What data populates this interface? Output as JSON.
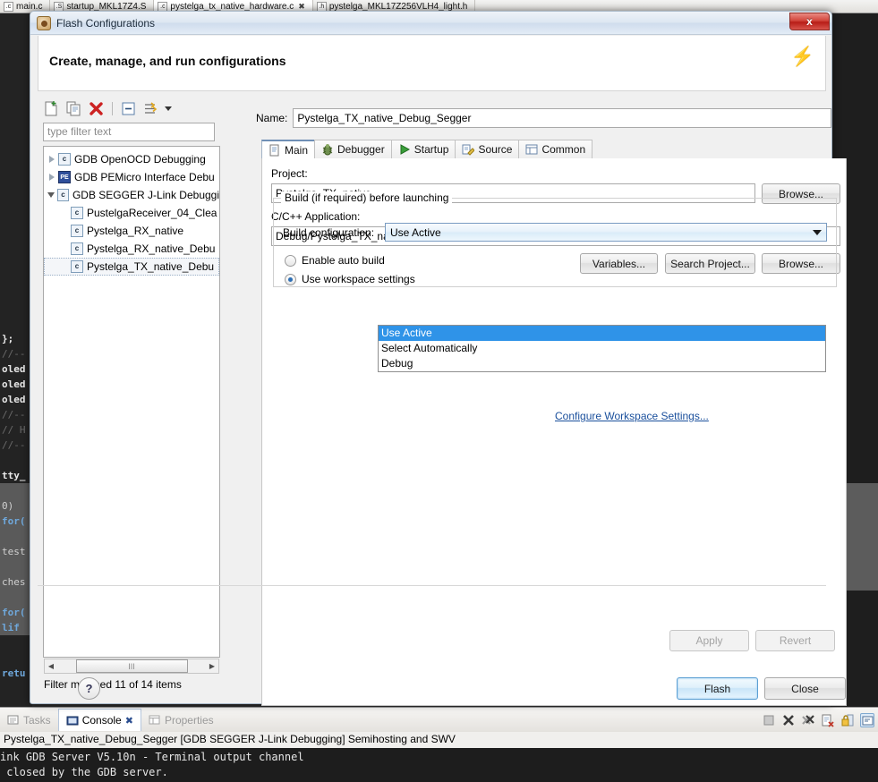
{
  "editor_tabs": [
    {
      "label": "main.c",
      "icon": "c-file-icon",
      "badge": ".c",
      "active": false,
      "closable": false
    },
    {
      "label": "startup_MKL17Z4.S",
      "icon": "asm-file-icon",
      "badge": ".S",
      "active": false,
      "closable": false
    },
    {
      "label": "pystelga_tx_native_hardware.c",
      "icon": "c-file-icon",
      "badge": ".c",
      "active": true,
      "closable": true
    },
    {
      "label": "pystelga_MKL17Z256VLH4_light.h",
      "icon": "h-file-icon",
      "badge": ".h",
      "active": false,
      "closable": false
    }
  ],
  "code_strip": [
    {
      "text": "};",
      "cls": "c-bold",
      "hl": false
    },
    {
      "text": "//--",
      "cls": "c-com",
      "hl": false
    },
    {
      "text": "oled",
      "cls": "c-bold",
      "hl": false
    },
    {
      "text": "oled",
      "cls": "c-bold",
      "hl": false
    },
    {
      "text": "oled",
      "cls": "c-bold",
      "hl": false
    },
    {
      "text": "//--",
      "cls": "c-com",
      "hl": false
    },
    {
      "text": "// H",
      "cls": "c-com",
      "hl": false
    },
    {
      "text": "//--",
      "cls": "c-com",
      "hl": false
    },
    {
      "text": "",
      "cls": "c-plain",
      "hl": false
    },
    {
      "text": "tty_",
      "cls": "c-bold",
      "hl": false
    },
    {
      "text": "",
      "cls": "c-plain",
      "hl": true
    },
    {
      "text": "0)",
      "cls": "c-plain",
      "hl": true
    },
    {
      "text": "for(",
      "cls": "c-kw",
      "hl": true
    },
    {
      "text": "",
      "cls": "c-plain",
      "hl": true
    },
    {
      "text": "test",
      "cls": "c-plain",
      "hl": true
    },
    {
      "text": "",
      "cls": "c-plain",
      "hl": true
    },
    {
      "text": "ches",
      "cls": "c-plain",
      "hl": true
    },
    {
      "text": "",
      "cls": "c-plain",
      "hl": true
    },
    {
      "text": "for(",
      "cls": "c-kw",
      "hl": true
    },
    {
      "text": "lif",
      "cls": "c-kw",
      "hl": true
    },
    {
      "text": "",
      "cls": "c-plain",
      "hl": false
    },
    {
      "text": "",
      "cls": "c-plain",
      "hl": false
    },
    {
      "text": "retu",
      "cls": "c-kw",
      "hl": false
    }
  ],
  "dialog": {
    "title": "Flash Configurations",
    "title_icon": "flash-config-icon",
    "close_label": "x",
    "header_title": "Create, manage, and run configurations",
    "header_icon": "lightning-bolt-icon"
  },
  "tree_toolbar": [
    {
      "name": "new-configuration-button",
      "icon": "new-document-icon"
    },
    {
      "name": "duplicate-configuration-button",
      "icon": "copy-icon"
    },
    {
      "name": "delete-configuration-button",
      "icon": "red-x-icon"
    },
    {
      "name": "collapse-all-button",
      "icon": "collapse-all-icon"
    },
    {
      "name": "filter-button",
      "icon": "filter-icon"
    }
  ],
  "filter": {
    "placeholder": "type filter text",
    "value": "",
    "status": "Filter matched 11 of 14 items"
  },
  "tree": [
    {
      "label": "GDB OpenOCD Debugging",
      "level": 0,
      "expander": "collapsed",
      "icon": "c-config-icon",
      "selected": false
    },
    {
      "label": "GDB PEMicro Interface Debu",
      "level": 0,
      "expander": "collapsed",
      "icon": "pemicro-icon",
      "selected": false
    },
    {
      "label": "GDB SEGGER J-Link Debuggi",
      "level": 0,
      "expander": "expanded",
      "icon": "c-config-icon",
      "selected": false
    },
    {
      "label": "PustelgaReceiver_04_Clea",
      "level": 1,
      "expander": "none",
      "icon": "c-config-icon",
      "selected": false
    },
    {
      "label": "Pystelga_RX_native",
      "level": 1,
      "expander": "none",
      "icon": "c-config-icon",
      "selected": false
    },
    {
      "label": "Pystelga_RX_native_Debu",
      "level": 1,
      "expander": "none",
      "icon": "c-config-icon",
      "selected": false
    },
    {
      "label": "Pystelga_TX_native_Debu",
      "level": 1,
      "expander": "none",
      "icon": "c-config-icon",
      "selected": true
    }
  ],
  "config": {
    "name_label": "Name:",
    "name_value": "Pystelga_TX_native_Debug_Segger",
    "tabs": [
      {
        "label": "Main",
        "icon": "document-icon",
        "active": true
      },
      {
        "label": "Debugger",
        "icon": "bug-icon",
        "active": false
      },
      {
        "label": "Startup",
        "icon": "green-play-icon",
        "active": false
      },
      {
        "label": "Source",
        "icon": "source-folder-icon",
        "active": false
      },
      {
        "label": "Common",
        "icon": "table-icon",
        "active": false
      }
    ],
    "project_label": "Project:",
    "project_value": "Pystelga_TX_native",
    "project_browse": "Browse...",
    "app_label": "C/C++ Application:",
    "app_value": "Debug/Pystelga_TX_native.elf",
    "app_variables": "Variables...",
    "app_search_project": "Search Project...",
    "app_browse": "Browse...",
    "build_group_label": "Build (if required) before launching",
    "build_config_label": "Build configuration:",
    "build_config_value": "Use Active",
    "build_config_options": [
      "Use Active",
      "Select Automatically",
      "Debug"
    ],
    "build_config_selected_index": 0,
    "radio_auto_build": "Enable auto build",
    "radio_auto_build_on": false,
    "radio_workspace": "Use workspace settings",
    "radio_workspace_on": true,
    "workspace_link": "Configure Workspace Settings..."
  },
  "buttons": {
    "apply": "Apply",
    "apply_enabled": false,
    "revert": "Revert",
    "revert_enabled": false,
    "flash": "Flash",
    "close": "Close",
    "help": "?"
  },
  "console": {
    "tabs": [
      {
        "label": "Tasks",
        "icon": "tasks-icon",
        "active": false
      },
      {
        "label": "Console",
        "icon": "console-icon",
        "active": true,
        "pinned": true
      },
      {
        "label": "Properties",
        "icon": "properties-icon",
        "active": false
      }
    ],
    "title": "Pystelga_TX_native_Debug_Segger [GDB SEGGER J-Link Debugging] Semihosting and SWV",
    "toolbar": [
      {
        "name": "stop-button",
        "icon": "stop-square-icon"
      },
      {
        "name": "terminate-button",
        "icon": "x-icon"
      },
      {
        "name": "remove-all-terminated-button",
        "icon": "double-x-icon"
      },
      {
        "name": "clear-console-button",
        "icon": "clear-console-icon"
      },
      {
        "name": "scroll-lock-button",
        "icon": "lock-icon"
      },
      {
        "name": "display-selected-console-button",
        "icon": "display-console-icon"
      }
    ],
    "output": [
      "ink GDB Server V5.10n - Terminal output channel",
      " closed by the GDB server."
    ]
  },
  "colors": {
    "accent": "#2f93e8",
    "link": "#1a4f9c",
    "close_red": "#b81d17",
    "bolt_yellow": "#f5c518"
  }
}
